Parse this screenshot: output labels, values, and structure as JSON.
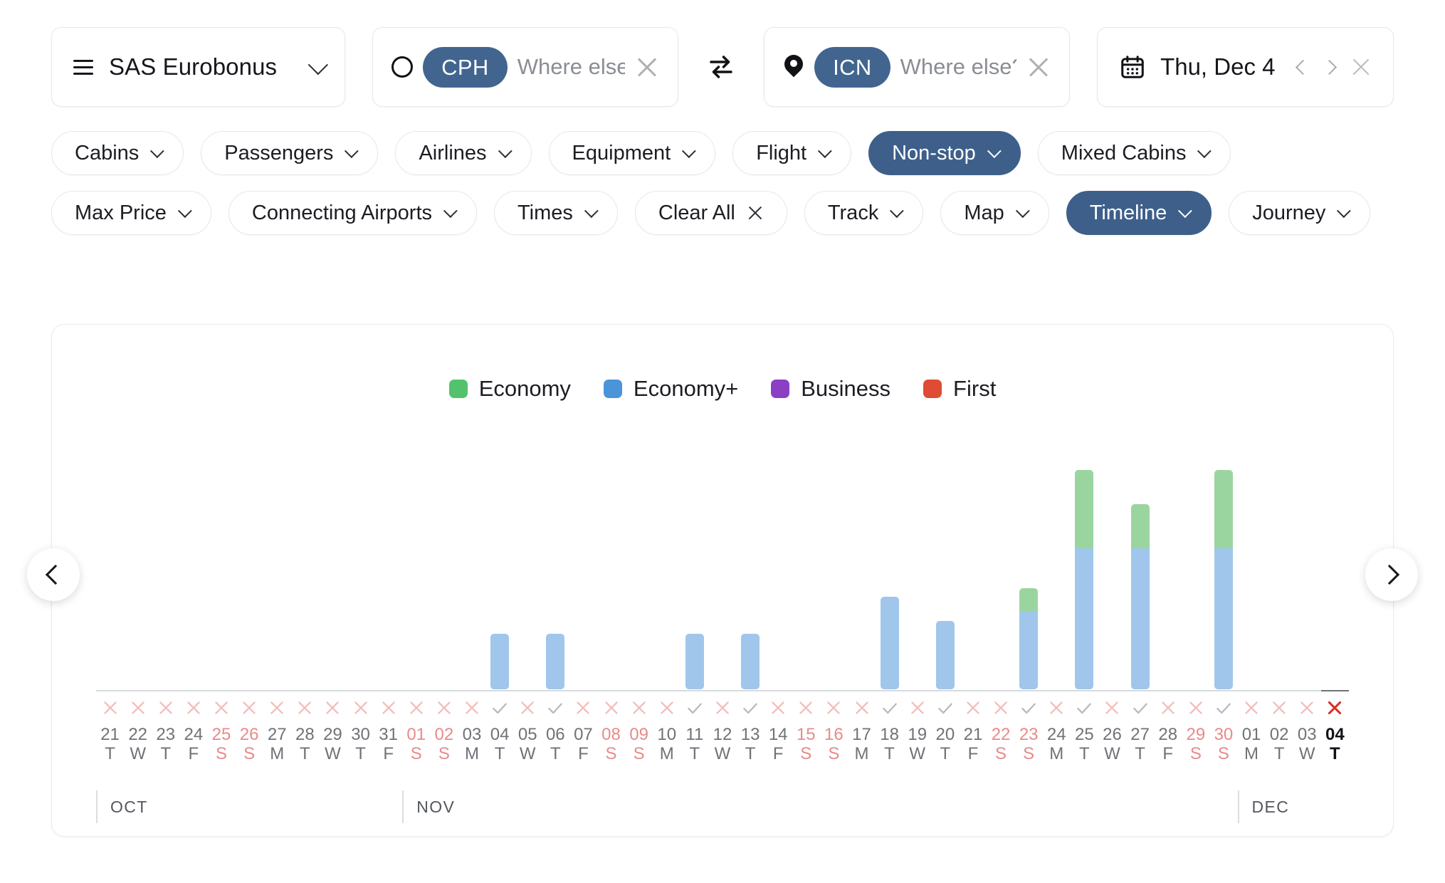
{
  "searchbar": {
    "program": {
      "label": "SAS Eurobonus",
      "menu_icon": "hamburger-icon",
      "chevron_icon": "chevron-down-icon"
    },
    "origin": {
      "icon": "circle-icon",
      "code": "CPH",
      "placeholder": "Where else?",
      "value": "",
      "clear_icon": "close-icon"
    },
    "swap": {
      "icon": "swap-arrows-icon"
    },
    "destination": {
      "icon": "map-pin-icon",
      "code": "ICN",
      "placeholder": "Where else?",
      "value": "",
      "clear_icon": "close-icon"
    },
    "date": {
      "icon": "calendar-icon",
      "label": "Thu, Dec 4",
      "prev_icon": "chevron-left-icon",
      "next_icon": "chevron-right-icon",
      "clear_icon": "close-icon"
    }
  },
  "filters": {
    "row1": [
      {
        "label": "Cabins",
        "active": false,
        "trailing": "chevron"
      },
      {
        "label": "Passengers",
        "active": false,
        "trailing": "chevron"
      },
      {
        "label": "Airlines",
        "active": false,
        "trailing": "chevron"
      },
      {
        "label": "Equipment",
        "active": false,
        "trailing": "chevron"
      },
      {
        "label": "Flight",
        "active": false,
        "trailing": "chevron"
      },
      {
        "label": "Non-stop",
        "active": true,
        "trailing": "chevron"
      },
      {
        "label": "Mixed Cabins",
        "active": false,
        "trailing": "chevron"
      }
    ],
    "row2": [
      {
        "label": "Max Price",
        "active": false,
        "trailing": "chevron"
      },
      {
        "label": "Connecting Airports",
        "active": false,
        "trailing": "chevron"
      },
      {
        "label": "Times",
        "active": false,
        "trailing": "chevron"
      },
      {
        "label": "Clear All",
        "active": false,
        "trailing": "close"
      },
      {
        "label": "Track",
        "active": false,
        "trailing": "chevron"
      },
      {
        "label": "Map",
        "active": false,
        "trailing": "chevron"
      },
      {
        "label": "Timeline",
        "active": true,
        "trailing": "chevron"
      },
      {
        "label": "Journey",
        "active": false,
        "trailing": "chevron"
      }
    ]
  },
  "panel": {
    "prev_button_icon": "chevron-left-icon",
    "next_button_icon": "chevron-right-icon"
  },
  "chart_data": {
    "type": "bar",
    "stacked": true,
    "title": "",
    "xlabel": "",
    "ylabel": "",
    "grid": false,
    "legend_position": "top-center",
    "legend": [
      {
        "name": "Economy",
        "color": "#53c26a"
      },
      {
        "name": "Economy+",
        "color": "#4a94d9"
      },
      {
        "name": "Business",
        "color": "#8b3fc4"
      },
      {
        "name": "First",
        "color": "#e04b33"
      }
    ],
    "series": [
      {
        "name": "Economy",
        "color": "#9ad5a0"
      },
      {
        "name": "Economy+",
        "color": "#a0c6ec"
      },
      {
        "name": "Business",
        "color": "#b79ae0"
      },
      {
        "name": "First",
        "color": "#f0a193"
      }
    ],
    "months": [
      {
        "label": "OCT",
        "start_index": 0
      },
      {
        "label": "NOV",
        "start_index": 11
      },
      {
        "label": "DEC",
        "start_index": 41
      }
    ],
    "columns": [
      {
        "day": "21",
        "weekday": "T",
        "weekend": false,
        "available": false,
        "selected": false,
        "economy": 0,
        "economy_plus": 0
      },
      {
        "day": "22",
        "weekday": "W",
        "weekend": false,
        "available": false,
        "selected": false,
        "economy": 0,
        "economy_plus": 0
      },
      {
        "day": "23",
        "weekday": "T",
        "weekend": false,
        "available": false,
        "selected": false,
        "economy": 0,
        "economy_plus": 0
      },
      {
        "day": "24",
        "weekday": "F",
        "weekend": false,
        "available": false,
        "selected": false,
        "economy": 0,
        "economy_plus": 0
      },
      {
        "day": "25",
        "weekday": "S",
        "weekend": true,
        "available": false,
        "selected": false,
        "economy": 0,
        "economy_plus": 0
      },
      {
        "day": "26",
        "weekday": "S",
        "weekend": true,
        "available": false,
        "selected": false,
        "economy": 0,
        "economy_plus": 0
      },
      {
        "day": "27",
        "weekday": "M",
        "weekend": false,
        "available": false,
        "selected": false,
        "economy": 0,
        "economy_plus": 0
      },
      {
        "day": "28",
        "weekday": "T",
        "weekend": false,
        "available": false,
        "selected": false,
        "economy": 0,
        "economy_plus": 0
      },
      {
        "day": "29",
        "weekday": "W",
        "weekend": false,
        "available": false,
        "selected": false,
        "economy": 0,
        "economy_plus": 0
      },
      {
        "day": "30",
        "weekday": "T",
        "weekend": false,
        "available": false,
        "selected": false,
        "economy": 0,
        "economy_plus": 0
      },
      {
        "day": "31",
        "weekday": "F",
        "weekend": false,
        "available": false,
        "selected": false,
        "economy": 0,
        "economy_plus": 0
      },
      {
        "day": "01",
        "weekday": "S",
        "weekend": true,
        "available": false,
        "selected": false,
        "economy": 0,
        "economy_plus": 0
      },
      {
        "day": "02",
        "weekday": "S",
        "weekend": true,
        "available": false,
        "selected": false,
        "economy": 0,
        "economy_plus": 0
      },
      {
        "day": "03",
        "weekday": "M",
        "weekend": false,
        "available": false,
        "selected": false,
        "economy": 0,
        "economy_plus": 0
      },
      {
        "day": "04",
        "weekday": "T",
        "weekend": false,
        "available": true,
        "selected": false,
        "economy": 0,
        "economy_plus": 78
      },
      {
        "day": "05",
        "weekday": "W",
        "weekend": false,
        "available": false,
        "selected": false,
        "economy": 0,
        "economy_plus": 0
      },
      {
        "day": "06",
        "weekday": "T",
        "weekend": false,
        "available": true,
        "selected": false,
        "economy": 0,
        "economy_plus": 78
      },
      {
        "day": "07",
        "weekday": "F",
        "weekend": false,
        "available": false,
        "selected": false,
        "economy": 0,
        "economy_plus": 0
      },
      {
        "day": "08",
        "weekday": "S",
        "weekend": true,
        "available": false,
        "selected": false,
        "economy": 0,
        "economy_plus": 0
      },
      {
        "day": "09",
        "weekday": "S",
        "weekend": true,
        "available": false,
        "selected": false,
        "economy": 0,
        "economy_plus": 0
      },
      {
        "day": "10",
        "weekday": "M",
        "weekend": false,
        "available": false,
        "selected": false,
        "economy": 0,
        "economy_plus": 0
      },
      {
        "day": "11",
        "weekday": "T",
        "weekend": false,
        "available": true,
        "selected": false,
        "economy": 0,
        "economy_plus": 78
      },
      {
        "day": "12",
        "weekday": "W",
        "weekend": false,
        "available": false,
        "selected": false,
        "economy": 0,
        "economy_plus": 0
      },
      {
        "day": "13",
        "weekday": "T",
        "weekend": false,
        "available": true,
        "selected": false,
        "economy": 0,
        "economy_plus": 78
      },
      {
        "day": "14",
        "weekday": "F",
        "weekend": false,
        "available": false,
        "selected": false,
        "economy": 0,
        "economy_plus": 0
      },
      {
        "day": "15",
        "weekday": "S",
        "weekend": true,
        "available": false,
        "selected": false,
        "economy": 0,
        "economy_plus": 0
      },
      {
        "day": "16",
        "weekday": "S",
        "weekend": true,
        "available": false,
        "selected": false,
        "economy": 0,
        "economy_plus": 0
      },
      {
        "day": "17",
        "weekday": "M",
        "weekend": false,
        "available": false,
        "selected": false,
        "economy": 0,
        "economy_plus": 0
      },
      {
        "day": "18",
        "weekday": "T",
        "weekend": false,
        "available": true,
        "selected": false,
        "economy": 0,
        "economy_plus": 130
      },
      {
        "day": "19",
        "weekday": "W",
        "weekend": false,
        "available": false,
        "selected": false,
        "economy": 0,
        "economy_plus": 0
      },
      {
        "day": "20",
        "weekday": "T",
        "weekend": false,
        "available": true,
        "selected": false,
        "economy": 0,
        "economy_plus": 96
      },
      {
        "day": "21",
        "weekday": "F",
        "weekend": false,
        "available": false,
        "selected": false,
        "economy": 0,
        "economy_plus": 0
      },
      {
        "day": "22",
        "weekday": "S",
        "weekend": true,
        "available": false,
        "selected": false,
        "economy": 0,
        "economy_plus": 0
      },
      {
        "day": "23",
        "weekday": "S",
        "weekend": true,
        "available": true,
        "selected": false,
        "economy": 32,
        "economy_plus": 110
      },
      {
        "day": "24",
        "weekday": "M",
        "weekend": false,
        "available": false,
        "selected": false,
        "economy": 0,
        "economy_plus": 0
      },
      {
        "day": "25",
        "weekday": "T",
        "weekend": false,
        "available": true,
        "selected": false,
        "economy": 110,
        "economy_plus": 198
      },
      {
        "day": "26",
        "weekday": "W",
        "weekend": false,
        "available": false,
        "selected": false,
        "economy": 0,
        "economy_plus": 0
      },
      {
        "day": "27",
        "weekday": "T",
        "weekend": false,
        "available": true,
        "selected": false,
        "economy": 62,
        "economy_plus": 198
      },
      {
        "day": "28",
        "weekday": "F",
        "weekend": false,
        "available": false,
        "selected": false,
        "economy": 0,
        "economy_plus": 0
      },
      {
        "day": "29",
        "weekday": "S",
        "weekend": true,
        "available": false,
        "selected": false,
        "economy": 0,
        "economy_plus": 0
      },
      {
        "day": "30",
        "weekday": "S",
        "weekend": true,
        "available": true,
        "selected": false,
        "economy": 110,
        "economy_plus": 198
      },
      {
        "day": "01",
        "weekday": "M",
        "weekend": false,
        "available": false,
        "selected": false,
        "economy": 0,
        "economy_plus": 0
      },
      {
        "day": "02",
        "weekday": "T",
        "weekend": false,
        "available": false,
        "selected": false,
        "economy": 0,
        "economy_plus": 0
      },
      {
        "day": "03",
        "weekday": "W",
        "weekend": false,
        "available": false,
        "selected": false,
        "economy": 0,
        "economy_plus": 0
      },
      {
        "day": "04",
        "weekday": "T",
        "weekend": false,
        "available": false,
        "selected": true,
        "economy": 0,
        "economy_plus": 0
      }
    ]
  }
}
